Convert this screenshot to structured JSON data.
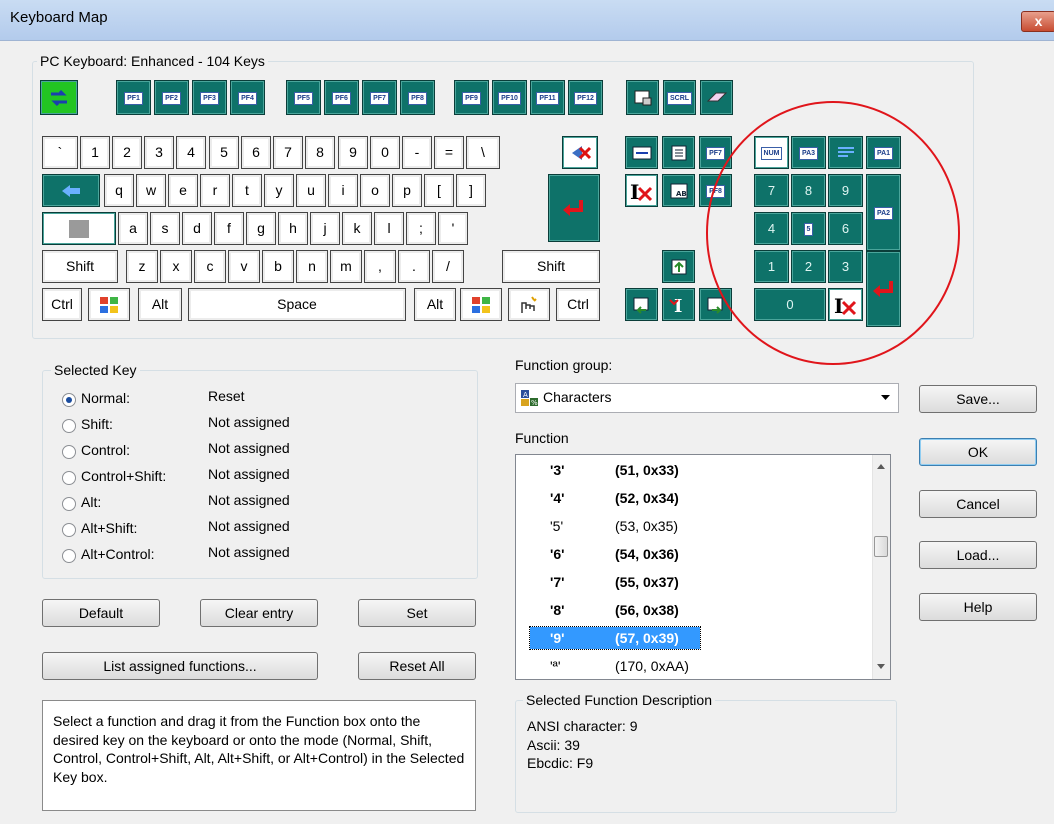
{
  "window": {
    "title": "Keyboard Map",
    "close_label": "x"
  },
  "keyboard": {
    "group_label": "PC Keyboard:  Enhanced - 104 Keys",
    "fkeys": [
      "PF1",
      "PF2",
      "PF3",
      "PF4",
      "PF5",
      "PF6",
      "PF7",
      "PF8",
      "PF9",
      "PF10",
      "PF11",
      "PF12"
    ],
    "scrl": "SCRL",
    "num_row": [
      "`",
      "1",
      "2",
      "3",
      "4",
      "5",
      "6",
      "7",
      "8",
      "9",
      "0",
      "-",
      "=",
      "\\"
    ],
    "top_row": [
      "q",
      "w",
      "e",
      "r",
      "t",
      "y",
      "u",
      "i",
      "o",
      "p",
      "[",
      "]"
    ],
    "home_row": [
      "a",
      "s",
      "d",
      "f",
      "g",
      "h",
      "j",
      "k",
      "l",
      ";",
      "'"
    ],
    "bottom_row": [
      "z",
      "x",
      "c",
      "v",
      "b",
      "n",
      "m",
      ",",
      ".",
      "/"
    ],
    "shift": "Shift",
    "ctrl": "Ctrl",
    "alt": "Alt",
    "space": "Space",
    "nav_labels": [
      "PF7",
      "PF8"
    ],
    "numpad_icons": [
      "NUM",
      "PA3",
      "PA1",
      "PA2",
      "5"
    ],
    "numpad_digits": [
      "7",
      "8",
      "9",
      "4",
      "6",
      "1",
      "2",
      "3",
      "0"
    ]
  },
  "selected_key": {
    "label": "Selected Key",
    "modes": [
      {
        "label": "Normal:",
        "value": "Reset",
        "checked": true
      },
      {
        "label": "Shift:",
        "value": "Not assigned"
      },
      {
        "label": "Control:",
        "value": "Not assigned"
      },
      {
        "label": "Control+Shift:",
        "value": "Not assigned"
      },
      {
        "label": "Alt:",
        "value": "Not assigned"
      },
      {
        "label": "Alt+Shift:",
        "value": "Not assigned"
      },
      {
        "label": "Alt+Control:",
        "value": "Not assigned"
      }
    ]
  },
  "function_group": {
    "label": "Function group:",
    "value": "Characters"
  },
  "function_list": {
    "label": "Function",
    "items": [
      {
        "c1": "'3'",
        "c2": "(51, 0x33)",
        "bold": true
      },
      {
        "c1": "'4'",
        "c2": "(52, 0x34)",
        "bold": true
      },
      {
        "c1": "'5'",
        "c2": "(53, 0x35)",
        "bold": false
      },
      {
        "c1": "'6'",
        "c2": "(54, 0x36)",
        "bold": true
      },
      {
        "c1": "'7'",
        "c2": "(55, 0x37)",
        "bold": true
      },
      {
        "c1": "'8'",
        "c2": "(56, 0x38)",
        "bold": true
      },
      {
        "c1": "'9'",
        "c2": "(57, 0x39)",
        "bold": true,
        "selected": true
      },
      {
        "c1": "'ª'",
        "c2": "(170, 0xAA)",
        "bold": false
      }
    ]
  },
  "description": {
    "label": "Selected Function Description",
    "lines": [
      "ANSI character: 9",
      "Ascii: 39",
      "Ebcdic: F9"
    ]
  },
  "buttons": {
    "save": "Save...",
    "ok": "OK",
    "cancel": "Cancel",
    "load": "Load...",
    "help": "Help",
    "default": "Default",
    "clear_entry": "Clear entry",
    "set": "Set",
    "list_assigned": "List assigned functions...",
    "reset_all": "Reset All"
  },
  "instructions": "Select a function and drag it from the Function box onto the desired key on the keyboard or onto the mode (Normal, Shift, Control, Control+Shift, Alt, Alt+Shift, or Alt+Control) in the Selected Key box.",
  "colors": {
    "key_teal": "#0e7269",
    "annotation_red": "#e0151b",
    "selection_blue": "#3399ff"
  }
}
